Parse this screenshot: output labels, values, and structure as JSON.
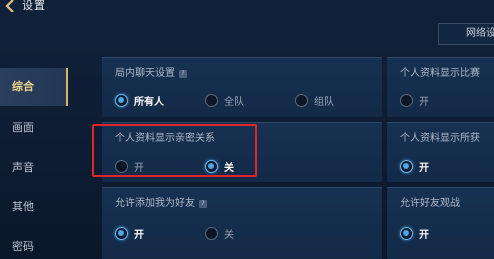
{
  "header": {
    "title": "设置",
    "network_button": "网络设"
  },
  "sidebar": {
    "items": [
      {
        "label": "综合",
        "active": true
      },
      {
        "label": "画面",
        "active": false
      },
      {
        "label": "声音",
        "active": false
      },
      {
        "label": "其他",
        "active": false
      },
      {
        "label": "密码",
        "active": false
      }
    ]
  },
  "settings": {
    "in_game_chat": {
      "title": "局内聊天设置",
      "options": [
        "所有人",
        "全队",
        "组队"
      ],
      "selected": "所有人"
    },
    "profile_display_relation": {
      "title": "个人资料显示亲密关系",
      "options": [
        "开",
        "关"
      ],
      "selected": "关"
    },
    "allow_add_friend": {
      "title": "允许添加我为好友",
      "options": [
        "开",
        "关"
      ],
      "selected": "开"
    },
    "profile_display_match": {
      "title": "个人资料显示比赛",
      "options": [
        "开"
      ],
      "selected": null
    },
    "profile_display_obtained": {
      "title": "个人资料显示所获",
      "options": [
        "开"
      ],
      "selected": "开"
    },
    "allow_friend_spectate": {
      "title": "允许好友观战",
      "options": [
        "开"
      ],
      "selected": "开"
    }
  },
  "icons": {
    "help": "?"
  },
  "colors": {
    "accent_gold": "#d9b463",
    "radio_on": "#4fa6e0",
    "highlight_red": "#e0262b"
  }
}
